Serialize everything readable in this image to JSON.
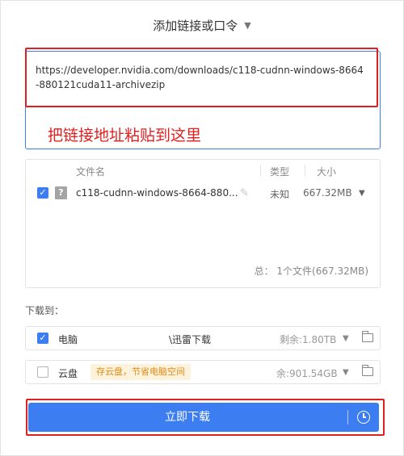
{
  "header": {
    "title": "添加链接或口令"
  },
  "url_input": {
    "value": "https://developer.nvidia.com/downloads/c118-cudnn-windows-8664-880121cuda11-archivezip"
  },
  "annotation": {
    "text": "把链接地址粘贴到这里"
  },
  "file_list": {
    "headers": {
      "name": "文件名",
      "type": "类型",
      "size": "大小"
    },
    "files": [
      {
        "name": "c118-cudnn-windows-8664-880...",
        "type": "未知",
        "size": "667.32MB",
        "checked": true
      }
    ],
    "total": "总： 1个文件(667.32MB)"
  },
  "save_to": {
    "label": "下载到：",
    "locations": [
      {
        "name": "电脑",
        "path": "\\迅雷下载",
        "free": "剩余:1.80TB",
        "checked": true
      },
      {
        "name": "云盘",
        "badge": "存云盘，节省电脑空间",
        "free": "余:901.54GB",
        "checked": false
      }
    ]
  },
  "download_button": {
    "label": "立即下载"
  },
  "colors": {
    "accent": "#3c7ef2",
    "annotation_red": "#e02020",
    "badge_bg": "#fdf3dc",
    "badge_text": "#e48a15"
  }
}
